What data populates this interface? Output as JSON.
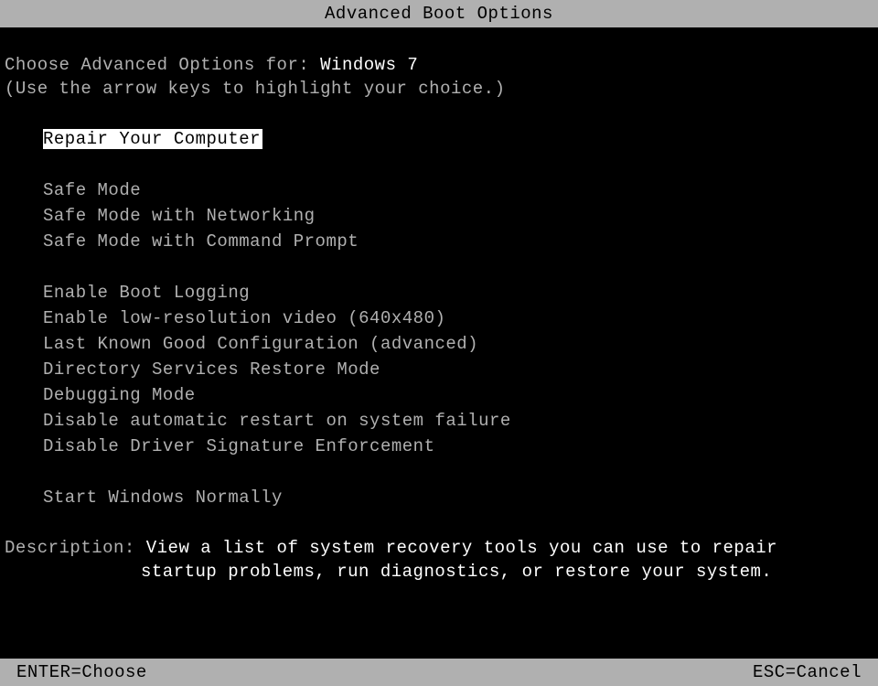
{
  "header": {
    "title": "Advanced Boot Options"
  },
  "prompt": {
    "label": "Choose Advanced Options for: ",
    "os_name": "Windows 7"
  },
  "instruction": "(Use the arrow keys to highlight your choice.)",
  "menu": {
    "groups": [
      {
        "items": [
          {
            "label": "Repair Your Computer",
            "selected": true
          }
        ]
      },
      {
        "items": [
          {
            "label": "Safe Mode",
            "selected": false
          },
          {
            "label": "Safe Mode with Networking",
            "selected": false
          },
          {
            "label": "Safe Mode with Command Prompt",
            "selected": false
          }
        ]
      },
      {
        "items": [
          {
            "label": "Enable Boot Logging",
            "selected": false
          },
          {
            "label": "Enable low-resolution video (640x480)",
            "selected": false
          },
          {
            "label": "Last Known Good Configuration (advanced)",
            "selected": false
          },
          {
            "label": "Directory Services Restore Mode",
            "selected": false
          },
          {
            "label": "Debugging Mode",
            "selected": false
          },
          {
            "label": "Disable automatic restart on system failure",
            "selected": false
          },
          {
            "label": "Disable Driver Signature Enforcement",
            "selected": false
          }
        ]
      },
      {
        "items": [
          {
            "label": "Start Windows Normally",
            "selected": false
          }
        ]
      }
    ]
  },
  "description": {
    "label": "Description: ",
    "line1": "View a list of system recovery tools you can use to repair",
    "line2": "startup problems, run diagnostics, or restore your system."
  },
  "footer": {
    "enter": "ENTER=Choose",
    "esc": "ESC=Cancel"
  }
}
